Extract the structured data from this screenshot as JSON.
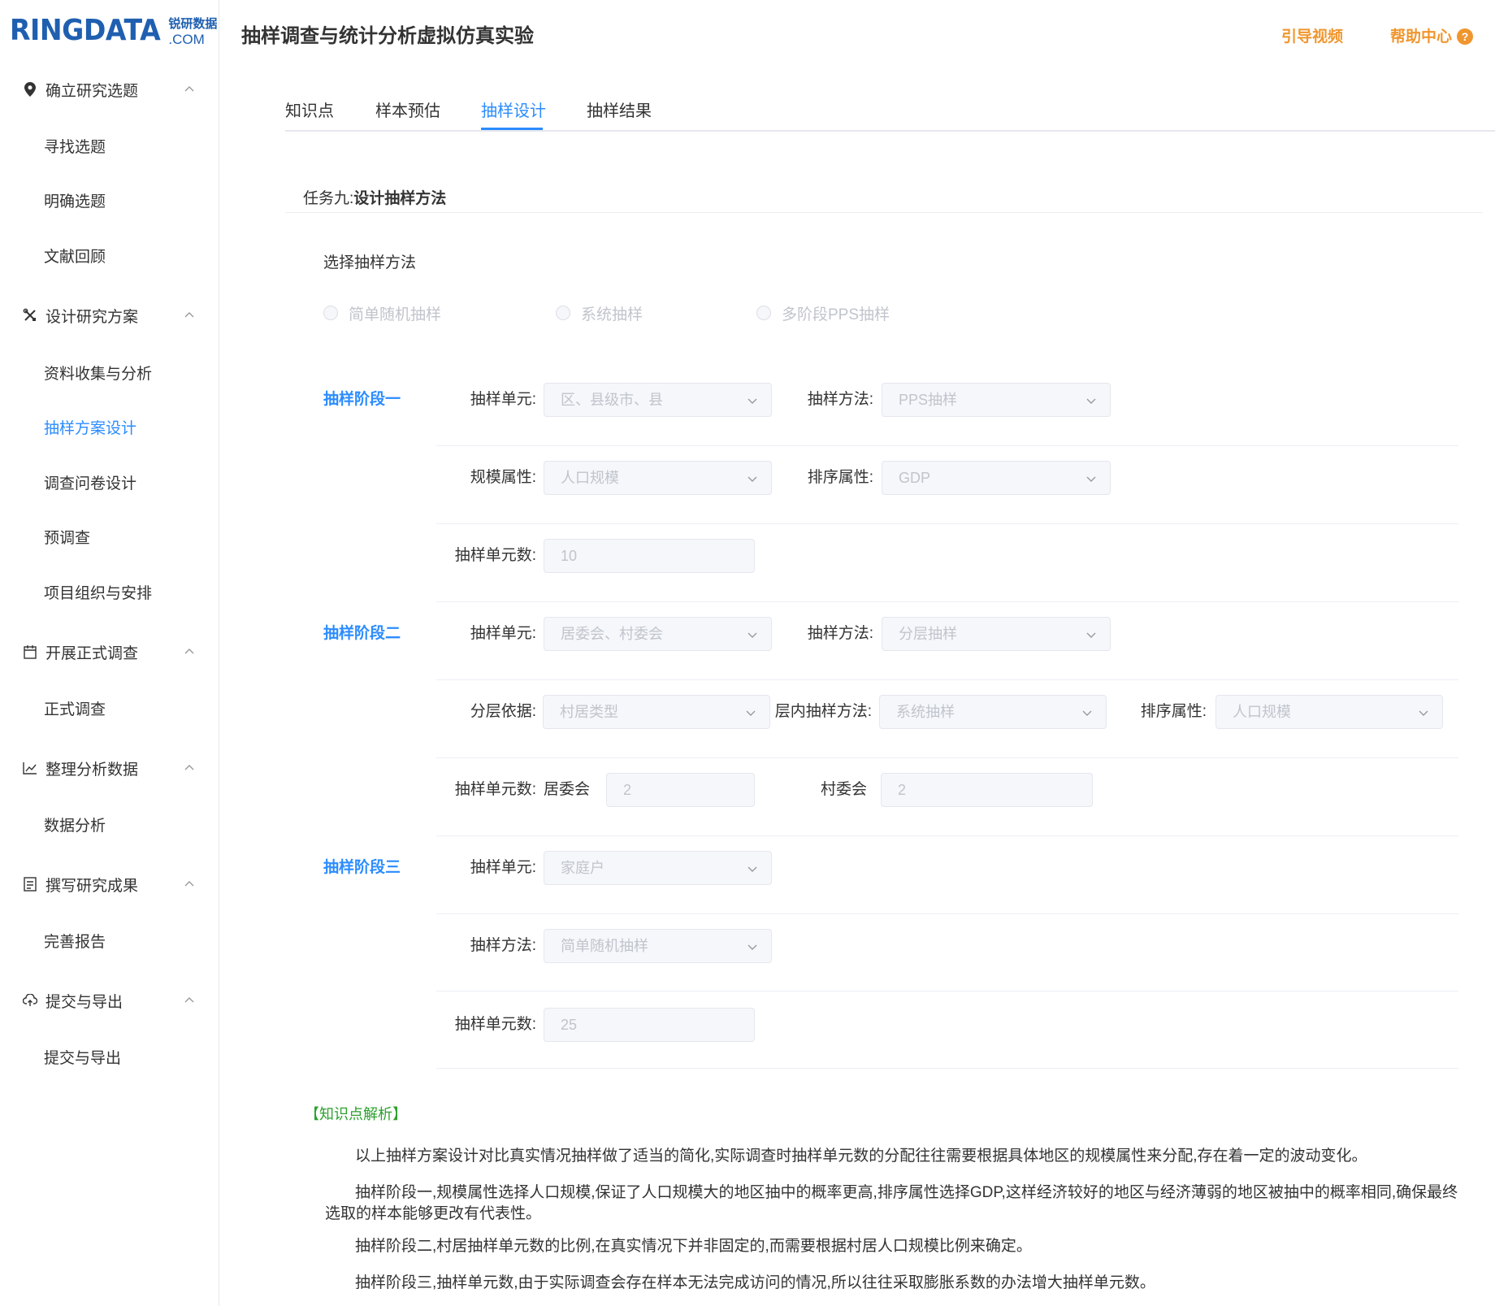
{
  "brand": {
    "wordmark": "RINGDATA",
    "cn": "锐研数据",
    "com": ".COM"
  },
  "app_title": "抽样调查与统计分析虚拟仿真实验",
  "header": {
    "guide_video": "引导视频",
    "help_center": "帮助中心",
    "help_icon": "?"
  },
  "sidebar": {
    "groups": [
      {
        "icon": "location-pin-icon",
        "label": "确立研究选题",
        "items": [
          "寻找选题",
          "明确选题",
          "文献回顾"
        ]
      },
      {
        "icon": "tools-icon",
        "label": "设计研究方案",
        "items": [
          "资料收集与分析",
          "抽样方案设计",
          "调查问卷设计",
          "预调查",
          "项目组织与安排"
        ]
      },
      {
        "icon": "calendar-icon",
        "label": "开展正式调查",
        "items": [
          "正式调查"
        ]
      },
      {
        "icon": "chart-icon",
        "label": "整理分析数据",
        "items": [
          "数据分析"
        ]
      },
      {
        "icon": "document-icon",
        "label": "撰写研究成果",
        "items": [
          "完善报告"
        ]
      },
      {
        "icon": "cloud-upload-icon",
        "label": "提交与导出",
        "items": [
          "提交与导出"
        ]
      }
    ],
    "active_item": "抽样方案设计"
  },
  "tabs": [
    {
      "label": "知识点",
      "active": false
    },
    {
      "label": "样本预估",
      "active": false
    },
    {
      "label": "抽样设计",
      "active": true
    },
    {
      "label": "抽样结果",
      "active": false
    }
  ],
  "task": {
    "prefix": "任务九:",
    "title": "设计抽样方法"
  },
  "method_section": {
    "label": "选择抽样方法",
    "options": [
      "简单随机抽样",
      "系统抽样",
      "多阶段PPS抽样"
    ]
  },
  "stage1": {
    "label": "抽样阶段一",
    "unit_label": "抽样单元:",
    "unit_value": "区、县级市、县",
    "method_label": "抽样方法:",
    "method_value": "PPS抽样",
    "scale_label": "规模属性:",
    "scale_value": "人口规模",
    "sort_label": "排序属性:",
    "sort_value": "GDP",
    "count_label": "抽样单元数:",
    "count_value": "10"
  },
  "stage2": {
    "label": "抽样阶段二",
    "unit_label": "抽样单元:",
    "unit_value": "居委会、村委会",
    "method_label": "抽样方法:",
    "method_value": "分层抽样",
    "strata_label": "分层依据:",
    "strata_value": "村居类型",
    "inner_label": "层内抽样方法:",
    "inner_value": "系统抽样",
    "sort_label": "排序属性:",
    "sort_value": "人口规模",
    "count_label": "抽样单元数:",
    "urban_label": "居委会",
    "urban_value": "2",
    "rural_label": "村委会",
    "rural_value": "2"
  },
  "stage3": {
    "label": "抽样阶段三",
    "unit_label": "抽样单元:",
    "unit_value": "家庭户",
    "method_label": "抽样方法:",
    "method_value": "简单随机抽样",
    "count_label": "抽样单元数:",
    "count_value": "25"
  },
  "knowledge": {
    "title": "【知识点解析】",
    "paragraphs": [
      "以上抽样方案设计对比真实情况抽样做了适当的简化,实际调查时抽样单元数的分配往往需要根据具体地区的规模属性来分配,存在着一定的波动变化。",
      "抽样阶段一,规模属性选择人口规模,保证了人口规模大的地区抽中的概率更高,排序属性选择GDP,这样经济较好的地区与经济薄弱的地区被抽中的概率相同,确保最终选取的样本能够更改有代表性。",
      "抽样阶段二,村居抽样单元数的比例,在真实情况下并非固定的,而需要根据村居人口规模比例来确定。",
      "抽样阶段三,抽样单元数,由于实际调查会存在样本无法完成访问的情况,所以往往采取膨胀系数的办法增大抽样单元数。"
    ]
  },
  "colors": {
    "accent": "#2b8cff",
    "orange": "#f0962e",
    "green": "#2ca02c",
    "disabled_text": "#c0c4cc"
  }
}
